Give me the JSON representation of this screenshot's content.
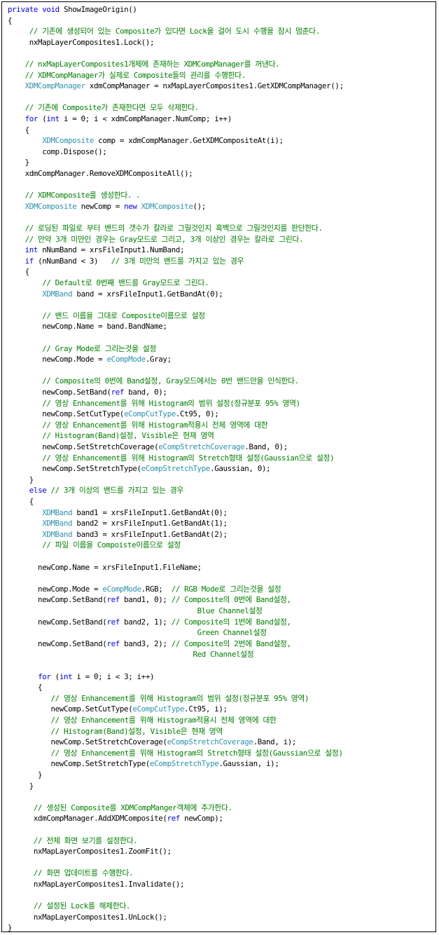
{
  "colors": {
    "keyword": "#0000ff",
    "type": "#2b91af",
    "comment": "#008000",
    "text": "#000000",
    "border": "#000000"
  },
  "code_lines": [
    [
      [
        "kw",
        "private void"
      ],
      [
        "tx",
        " ShowImageOrigin()"
      ]
    ],
    [
      [
        "tx",
        "{"
      ]
    ],
    [
      [
        "tx",
        "     "
      ],
      [
        "cm",
        "// 기존에 생성되어 있는 Composite가 있다면 Lock을 걸어 도시 수행을 잠시 멈춘다."
      ]
    ],
    [
      [
        "tx",
        "     nxMapLayerComposites1.Lock();"
      ]
    ],
    [],
    [
      [
        "tx",
        "    "
      ],
      [
        "cm",
        "// nxMapLayerComposites1개체에 존재하는 XDMCompManager를 꺼낸다."
      ]
    ],
    [
      [
        "tx",
        "    "
      ],
      [
        "cm",
        "// XDMCompManager가 실제로 Composite들의 관리를 수행한다."
      ]
    ],
    [
      [
        "tx",
        "    "
      ],
      [
        "tp",
        "XDMCompManager"
      ],
      [
        "tx",
        " xdmCompManager = nxMapLayerComposites1.GetXDMCompManager();"
      ]
    ],
    [],
    [
      [
        "tx",
        "    "
      ],
      [
        "cm",
        "// 기존에 Composite가 존재한다면 모두 삭제한다."
      ]
    ],
    [
      [
        "tx",
        "    "
      ],
      [
        "kw",
        "for"
      ],
      [
        "tx",
        " ("
      ],
      [
        "kw",
        "int"
      ],
      [
        "tx",
        " i = 0; i < xdmCompManager.NumComp; i++)"
      ]
    ],
    [
      [
        "tx",
        "    {"
      ]
    ],
    [
      [
        "tx",
        "        "
      ],
      [
        "tp",
        "XDMComposite"
      ],
      [
        "tx",
        " comp = xdmCompManager.GetXDMCompositeAt(i);"
      ]
    ],
    [
      [
        "tx",
        "        comp.Dispose();"
      ]
    ],
    [
      [
        "tx",
        "    }"
      ]
    ],
    [
      [
        "tx",
        "    xdmCompManager.RemoveXDMCompositeAll();"
      ]
    ],
    [],
    [
      [
        "tx",
        "    "
      ],
      [
        "cm",
        "// XDMComposite를 생성한다. ."
      ]
    ],
    [
      [
        "tx",
        "    "
      ],
      [
        "tp",
        "XDMComposite"
      ],
      [
        "tx",
        " newComp = "
      ],
      [
        "kw",
        "new"
      ],
      [
        "tx",
        " "
      ],
      [
        "tp",
        "XDMComposite"
      ],
      [
        "tx",
        "();"
      ]
    ],
    [],
    [
      [
        "tx",
        "    "
      ],
      [
        "cm",
        "// 로딩된 파일로 부터 밴드의 갯수가 칼라로 그릴것인지 흑백으로 그릴것인지를 판단한다."
      ]
    ],
    [
      [
        "tx",
        "    "
      ],
      [
        "cm",
        "// 만약 3개 미만인 경우는 Gray모드로 그리고, 3개 이상인 경우는 칼라로 그린다."
      ]
    ],
    [
      [
        "tx",
        "    "
      ],
      [
        "kw",
        "int"
      ],
      [
        "tx",
        " nNumBand = xrsFileInput1.NumBand;"
      ]
    ],
    [
      [
        "tx",
        "    "
      ],
      [
        "kw",
        "if"
      ],
      [
        "tx",
        " (nNumBand < 3)   "
      ],
      [
        "cm",
        "// 3개 미만의 밴드를 가지고 있는 경우"
      ]
    ],
    [
      [
        "tx",
        "    {"
      ]
    ],
    [
      [
        "tx",
        "        "
      ],
      [
        "cm",
        "// Default로 0번째 밴드를 Gray모드로 그린다."
      ]
    ],
    [
      [
        "tx",
        "        "
      ],
      [
        "tp",
        "XDMBand"
      ],
      [
        "tx",
        " band = xrsFileInput1.GetBandAt(0);"
      ]
    ],
    [],
    [
      [
        "tx",
        "        "
      ],
      [
        "cm",
        "// 밴드 이름을 그대로 Composite이름으로 설정"
      ]
    ],
    [
      [
        "tx",
        "        newComp.Name = band.BandName;"
      ]
    ],
    [],
    [
      [
        "tx",
        "        "
      ],
      [
        "cm",
        "// Gray Mode로 그리는것을 설정"
      ]
    ],
    [
      [
        "tx",
        "        newComp.Mode = "
      ],
      [
        "tp",
        "eCompMode"
      ],
      [
        "tx",
        ".Gray;"
      ]
    ],
    [],
    [
      [
        "tx",
        "        "
      ],
      [
        "cm",
        "// Composite의 0번에 Band설정, Gray모드에서는 0번 밴드만을 인식한다."
      ]
    ],
    [
      [
        "tx",
        "        newComp.SetBand("
      ],
      [
        "kw",
        "ref"
      ],
      [
        "tx",
        " band, 0);"
      ]
    ],
    [
      [
        "tx",
        "        "
      ],
      [
        "cm",
        "// 영상 Enhancement를 위해 Histogram의 범위 설정(정규분포 95% 영역)"
      ]
    ],
    [
      [
        "tx",
        "        newComp.SetCutType("
      ],
      [
        "tp",
        "eCompCutType"
      ],
      [
        "tx",
        ".Ct95, 0);"
      ]
    ],
    [
      [
        "tx",
        "        "
      ],
      [
        "cm",
        "// 영상 Enhancement를 위해 Histogram적용시 전체 영역에 대한"
      ]
    ],
    [
      [
        "tx",
        "        "
      ],
      [
        "cm",
        "// Histogram(Band)설정, Visible은 현재 영역"
      ]
    ],
    [
      [
        "tx",
        "        newComp.SetStretchCoverage("
      ],
      [
        "tp",
        "eCompStretchCoverage"
      ],
      [
        "tx",
        ".Band, 0);"
      ]
    ],
    [
      [
        "tx",
        "        "
      ],
      [
        "cm",
        "// 영상 Enhancement를 위해 Histogram의 Stretch형태 설정(Gaussian으로 설정)"
      ]
    ],
    [
      [
        "tx",
        "        newComp.SetStretchType("
      ],
      [
        "tp",
        "eCompStretchType"
      ],
      [
        "tx",
        ".Gaussian, 0);"
      ]
    ],
    [
      [
        "tx",
        "     }"
      ]
    ],
    [
      [
        "tx",
        "     "
      ],
      [
        "kw",
        "else"
      ],
      [
        "tx",
        " "
      ],
      [
        "cm",
        "// 3개 이상의 밴드를 가지고 있는 경우"
      ]
    ],
    [
      [
        "tx",
        "     {"
      ]
    ],
    [
      [
        "tx",
        "        "
      ],
      [
        "tp",
        "XDMBand"
      ],
      [
        "tx",
        " band1 = xrsFileInput1.GetBandAt(0);"
      ]
    ],
    [
      [
        "tx",
        "        "
      ],
      [
        "tp",
        "XDMBand"
      ],
      [
        "tx",
        " band2 = xrsFileInput1.GetBandAt(1);"
      ]
    ],
    [
      [
        "tx",
        "        "
      ],
      [
        "tp",
        "XDMBand"
      ],
      [
        "tx",
        " band3 = xrsFileInput1.GetBandAt(2);"
      ]
    ],
    [
      [
        "tx",
        "        "
      ],
      [
        "cm",
        "// 파일 이름을 Compoiste이름으로 설정"
      ]
    ],
    [],
    [
      [
        "tx",
        "       newComp.Name = xrsFileInput1.FileName;"
      ]
    ],
    [],
    [
      [
        "tx",
        "       newComp.Mode = "
      ],
      [
        "tp",
        "eCompMode"
      ],
      [
        "tx",
        ".RGB;  "
      ],
      [
        "cm",
        "// RGB Mode로 그리는것을 설정"
      ]
    ],
    [
      [
        "tx",
        "       newComp.SetBand("
      ],
      [
        "kw",
        "ref"
      ],
      [
        "tx",
        " band1, 0); "
      ],
      [
        "cm",
        "// Composite의 0번에 Band설정,"
      ]
    ],
    [
      [
        "tx",
        "                                            "
      ],
      [
        "cm",
        "Blue Channel설정"
      ]
    ],
    [
      [
        "tx",
        "       newComp.SetBand("
      ],
      [
        "kw",
        "ref"
      ],
      [
        "tx",
        " band2, 1); "
      ],
      [
        "cm",
        "// Composite의 1번에 Band설정,"
      ]
    ],
    [
      [
        "tx",
        "                                            "
      ],
      [
        "cm",
        "Green Channel설정"
      ]
    ],
    [
      [
        "tx",
        "       newComp.SetBand("
      ],
      [
        "kw",
        "ref"
      ],
      [
        "tx",
        " band3, 2); "
      ],
      [
        "cm",
        "// Composite의 2번에 Band설정,"
      ]
    ],
    [
      [
        "tx",
        "                                           "
      ],
      [
        "cm",
        "Red Channel설정"
      ]
    ],
    [],
    [
      [
        "tx",
        "       "
      ],
      [
        "kw",
        "for"
      ],
      [
        "tx",
        " ("
      ],
      [
        "kw",
        "int"
      ],
      [
        "tx",
        " i = 0; i < 3; i++)"
      ]
    ],
    [
      [
        "tx",
        "       {"
      ]
    ],
    [
      [
        "tx",
        "          "
      ],
      [
        "cm",
        "// 영상 Enhancement를 위해 Histogram의 범위 설정(정규분포 95% 영역)"
      ]
    ],
    [
      [
        "tx",
        "          newComp.SetCutType("
      ],
      [
        "tp",
        "eCompCutType"
      ],
      [
        "tx",
        ".Ct95, i);"
      ]
    ],
    [
      [
        "tx",
        "          "
      ],
      [
        "cm",
        "// 영상 Enhancement를 위해 Histogram적용시 전체 영역에 대한"
      ]
    ],
    [
      [
        "tx",
        "          "
      ],
      [
        "cm",
        "// Histogram(Band)설정, Visible은 현재 영역"
      ]
    ],
    [
      [
        "tx",
        "          newComp.SetStretchCoverage("
      ],
      [
        "tp",
        "eCompStretchCoverage"
      ],
      [
        "tx",
        ".Band, i);"
      ]
    ],
    [
      [
        "tx",
        "          "
      ],
      [
        "cm",
        "// 영상 Enhancement를 위해 Histogram의 Stretch형태 설정(Gaussian으로 설정)"
      ]
    ],
    [
      [
        "tx",
        "          newComp.SetStretchType("
      ],
      [
        "tp",
        "eCompStretchType"
      ],
      [
        "tx",
        ".Gaussian, i);"
      ]
    ],
    [
      [
        "tx",
        "       }"
      ]
    ],
    [
      [
        "tx",
        "     }"
      ]
    ],
    [],
    [
      [
        "tx",
        "      "
      ],
      [
        "cm",
        "// 생성된 Composite를 XDMCompManger객체에 추가한다."
      ]
    ],
    [
      [
        "tx",
        "      xdmCompManager.AddXDMComposite("
      ],
      [
        "kw",
        "ref"
      ],
      [
        "tx",
        " newComp);"
      ]
    ],
    [],
    [
      [
        "tx",
        "      "
      ],
      [
        "cm",
        "// 전체 화면 보기를 설정한다."
      ]
    ],
    [
      [
        "tx",
        "      nxMapLayerComposites1.ZoomFit();"
      ]
    ],
    [],
    [
      [
        "tx",
        "      "
      ],
      [
        "cm",
        "// 화면 업데이트를 수행한다."
      ]
    ],
    [
      [
        "tx",
        "      nxMapLayerComposites1.Invalidate();"
      ]
    ],
    [],
    [
      [
        "tx",
        "      "
      ],
      [
        "cm",
        "// 설정된 Lock를 해제한다."
      ]
    ],
    [
      [
        "tx",
        "      nxMapLayerComposites1.UnLock();"
      ]
    ],
    [
      [
        "tx",
        "}"
      ]
    ]
  ]
}
